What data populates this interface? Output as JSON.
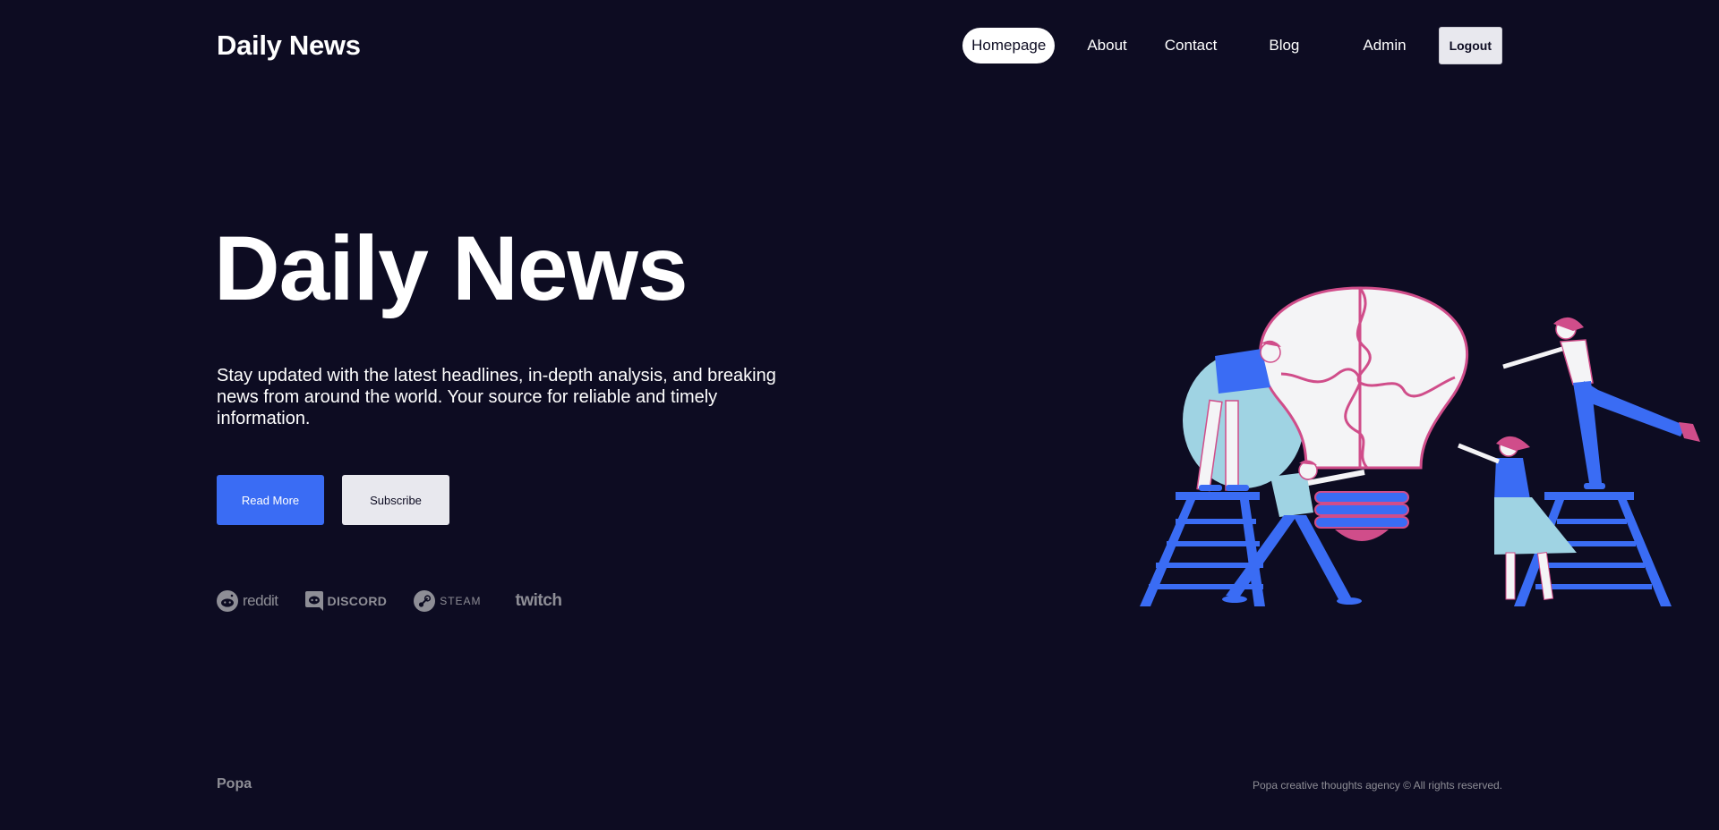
{
  "header": {
    "logo": "Daily News",
    "nav": [
      {
        "label": "Homepage",
        "active": true
      },
      {
        "label": "About"
      },
      {
        "label": "Contact"
      },
      {
        "label": "Blog"
      },
      {
        "label": "Admin"
      }
    ],
    "logout_label": "Logout"
  },
  "hero": {
    "title": "Daily News",
    "subtitle": "Stay updated with the latest headlines, in-depth analysis, and breaking news from around the world. Your source for reliable and timely information.",
    "read_more_label": "Read More",
    "subscribe_label": "Subscribe"
  },
  "partners": [
    {
      "name": "reddit",
      "icon": "reddit-icon"
    },
    {
      "name": "DISCORD",
      "icon": "discord-icon"
    },
    {
      "name": "STEAM",
      "icon": "steam-icon"
    },
    {
      "name": "twitch",
      "icon": "twitch-icon"
    }
  ],
  "footer": {
    "brand": "Popa",
    "copyright": "Popa creative thoughts agency © All rights reserved."
  },
  "colors": {
    "background": "#0d0c22",
    "accent": "#3a6cf4",
    "pink": "#d04d8a",
    "light_blue": "#9fd3e3",
    "muted": "#8e8e96"
  }
}
